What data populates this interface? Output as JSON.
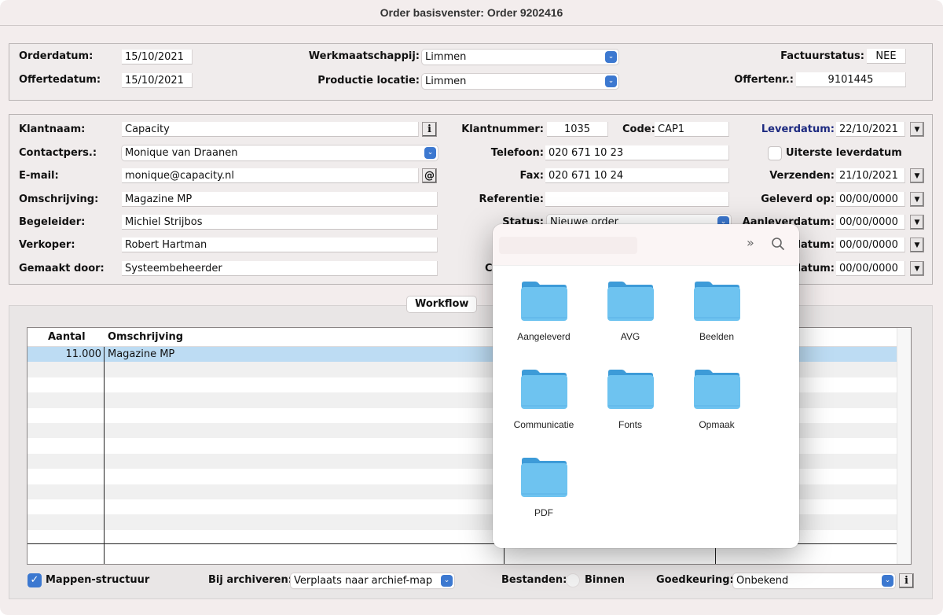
{
  "window": {
    "title": "Order basisvenster: Order 9202416"
  },
  "header": {
    "orderdatum": {
      "label": "Orderdatum:",
      "value": "15/10/2021"
    },
    "offertedatum": {
      "label": "Offertedatum:",
      "value": "15/10/2021"
    },
    "werkmaatschappij": {
      "label": "Werkmaatschappij:",
      "value": "Limmen"
    },
    "productie_locatie": {
      "label": "Productie locatie:",
      "value": "Limmen"
    },
    "factuurstatus": {
      "label": "Factuurstatus:",
      "value": "NEE"
    },
    "offertenr": {
      "label": "Offertenr.:",
      "value": "9101445"
    }
  },
  "customer": {
    "klantnaam": {
      "label": "Klantnaam:",
      "value": "Capacity"
    },
    "contactpers": {
      "label": "Contactpers.:",
      "value": "Monique van Draanen"
    },
    "email": {
      "label": "E-mail:",
      "value": "monique@capacity.nl"
    },
    "omschrijving": {
      "label": "Omschrijving:",
      "value": "Magazine MP"
    },
    "begeleider": {
      "label": "Begeleider:",
      "value": "Michiel Strijbos"
    },
    "verkoper": {
      "label": "Verkoper:",
      "value": "Robert Hartman"
    },
    "gemaakt_door": {
      "label": "Gemaakt door:",
      "value": "Systeembeheerder"
    },
    "klantnummer": {
      "label": "Klantnummer:",
      "value": "1035"
    },
    "code": {
      "label": "Code:",
      "value": "CAP1"
    },
    "telefoon": {
      "label": "Telefoon:",
      "value": "020 671 10 23"
    },
    "fax": {
      "label": "Fax:",
      "value": "020 671 10 24"
    },
    "referentie": {
      "label": "Referentie:",
      "value": ""
    },
    "status": {
      "label": "Status:",
      "value": "Nieuwe order"
    },
    "hidden_label_c": "C",
    "info_icon_glyph": "i",
    "at_icon_glyph": "@"
  },
  "dates": {
    "leverdatum": {
      "label": "Leverdatum:",
      "value": "22/10/2021"
    },
    "uiterste_leverdatum": {
      "label": "Uiterste leverdatum",
      "checked": false
    },
    "verzenden": {
      "label": "Verzenden:",
      "value": "21/10/2021"
    },
    "geleverd_op": {
      "label": "Geleverd op:",
      "value": "00/00/0000"
    },
    "aanleverdatum": {
      "label": "Aanleverdatum:",
      "value": "00/00/0000"
    },
    "datum_6": {
      "label": "datum:",
      "value": "00/00/0000"
    },
    "datum_7": {
      "label": "datum:",
      "value": "00/00/0000"
    },
    "dropdown_glyph": "▼"
  },
  "workflow": {
    "tab_label": "Workflow",
    "columns": [
      "Aantal",
      "Omschrijving"
    ],
    "rows": [
      {
        "aantal": "11.000",
        "omschrijving": "Magazine MP",
        "selected": true
      }
    ],
    "mappen_structuur": {
      "label": "Mappen-structuur",
      "checked": true,
      "check_glyph": "✓"
    },
    "bij_archiveren": {
      "label": "Bij archiveren:",
      "value": "Verplaats naar archief-map"
    },
    "bestanden": {
      "label": "Bestanden:",
      "option": "Binnen"
    },
    "goedkeuring": {
      "label": "Goedkeuring:",
      "value": "Onbekend"
    },
    "info_icon_glyph": "i"
  },
  "popover": {
    "more_glyph": "»",
    "folders": [
      "Aangeleverd",
      "AVG",
      "Beelden",
      "Communicatie",
      "Fonts",
      "Opmaak",
      "PDF"
    ],
    "folder_color": "#6ec3f0"
  },
  "colors": {
    "accent": "#3c78d0",
    "selection": "#bddcf3",
    "leverdatum_label": "#1d2a80"
  }
}
